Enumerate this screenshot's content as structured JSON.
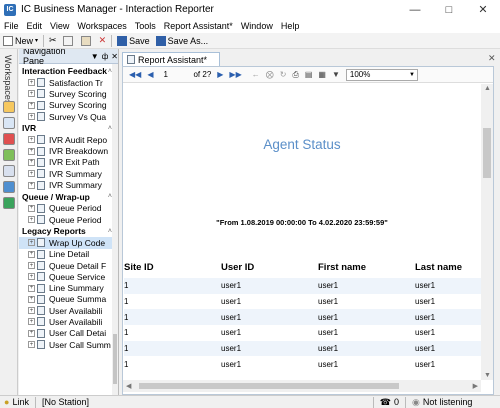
{
  "window": {
    "title": "IC Business Manager - Interaction Reporter",
    "app_icon_glyph": "IC"
  },
  "menu": [
    "File",
    "Edit",
    "View",
    "Workspaces",
    "Tools",
    "Report Assistant*",
    "Window",
    "Help"
  ],
  "toolbar": {
    "new_label": "New",
    "save_label": "Save",
    "save_as_label": "Save As..."
  },
  "workspaces_label": "Workspaces",
  "nav_pane": {
    "title": "Navigation Pane",
    "sections": [
      {
        "label": "Interaction Feedback",
        "items": [
          "Satisfaction Tr",
          "Survey Scoring",
          "Survey Scoring",
          "Survey Vs Qua"
        ]
      },
      {
        "label": "IVR",
        "items": [
          "IVR Audit Repo",
          "IVR Breakdown",
          "IVR Exit Path",
          "IVR Summary",
          "IVR Summary"
        ]
      },
      {
        "label": "Queue / Wrap-up",
        "items": [
          "Queue Period",
          "Queue Period"
        ]
      },
      {
        "label": "Legacy Reports",
        "items": [
          "Wrap Up Code",
          "Line Detail",
          "Queue Detail F",
          "Queue Service",
          "Line Summary",
          "Queue Summa",
          "User Availabili",
          "User Availabili",
          "User Call Detai",
          "User Call Summ"
        ]
      }
    ]
  },
  "doc_tab": {
    "label": "Report Assistant*"
  },
  "report_toolbar": {
    "page_value": "1",
    "page_of": "of 2?",
    "zoom": "100%"
  },
  "report": {
    "title": "Agent Status",
    "date_range": "\"From 1.08.2019 00:00:00 To 4.02.2020 23:59:59\"",
    "columns": [
      "Site ID",
      "User ID",
      "First name",
      "Last name"
    ],
    "rows": [
      [
        "1",
        "user1",
        "user1",
        "user1"
      ],
      [
        "1",
        "user1",
        "user1",
        "user1"
      ],
      [
        "1",
        "user1",
        "user1",
        "user1"
      ],
      [
        "1",
        "user1",
        "user1",
        "user1"
      ],
      [
        "1",
        "user1",
        "user1",
        "user1"
      ],
      [
        "1",
        "user1",
        "user1",
        "user1"
      ]
    ]
  },
  "statusbar": {
    "link": "Link",
    "station": "[No Station]",
    "count": "0",
    "listening": "Not listening"
  },
  "colors": {
    "accent": "#2f6fb7",
    "report_title": "#5b8fc8",
    "row_alt": "#eef4fb"
  }
}
